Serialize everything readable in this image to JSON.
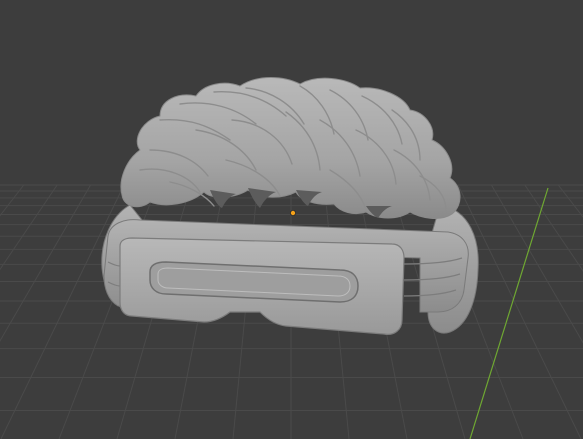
{
  "app": "3D viewport",
  "viewport": {
    "background_color": "#3d3d3d",
    "grid_line_color": "#4a4a4a",
    "y_axis_color": "#6fa832",
    "origin_color": "#f4a11a",
    "object_color": "#a8a8a8"
  },
  "object": {
    "name": "hair-with-visor-headband",
    "parts": [
      "hair-mesh",
      "headband-ring",
      "visor-plate"
    ]
  }
}
